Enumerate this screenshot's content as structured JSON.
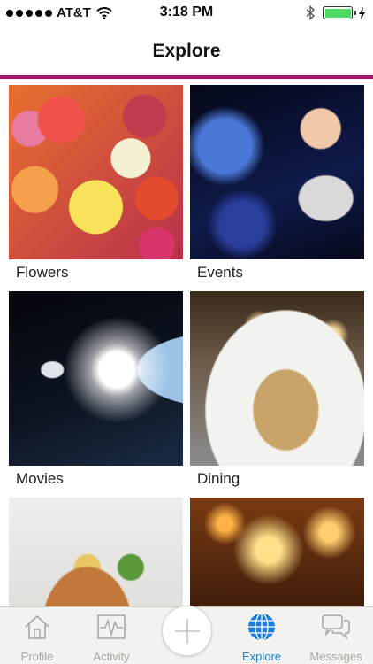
{
  "status_bar": {
    "carrier": "AT&T",
    "time": "3:18 PM",
    "signal_icon": "signal-dots-icon",
    "wifi_icon": "wifi-icon",
    "bluetooth_icon": "bluetooth-icon",
    "battery_icon": "battery-icon",
    "battery_level": 1.0,
    "battery_color": "#4cd964"
  },
  "nav": {
    "title": "Explore",
    "accent_color": "#a6126f"
  },
  "grid": {
    "tiles": [
      {
        "label": "Flowers",
        "image": "roses-photo"
      },
      {
        "label": "Events",
        "image": "woman-cocktail-photo"
      },
      {
        "label": "Movies",
        "image": "astronaut-space-photo"
      },
      {
        "label": "Dining",
        "image": "plated-dish-photo"
      },
      {
        "label": "",
        "image": "takeout-noodles-photo"
      },
      {
        "label": "",
        "image": "concert-crowd-photo"
      }
    ]
  },
  "tab_bar": {
    "active_color": "#1e7ed8",
    "inactive_color": "#a9a7a3",
    "tabs": [
      {
        "label": "Profile",
        "icon": "house-icon",
        "active": false
      },
      {
        "label": "Activity",
        "icon": "pulse-chart-icon",
        "active": false
      },
      {
        "label": "",
        "icon": "plus-icon",
        "active": false
      },
      {
        "label": "Explore",
        "icon": "globe-icon",
        "active": true
      },
      {
        "label": "Messages",
        "icon": "chat-bubbles-icon",
        "active": false
      }
    ]
  }
}
